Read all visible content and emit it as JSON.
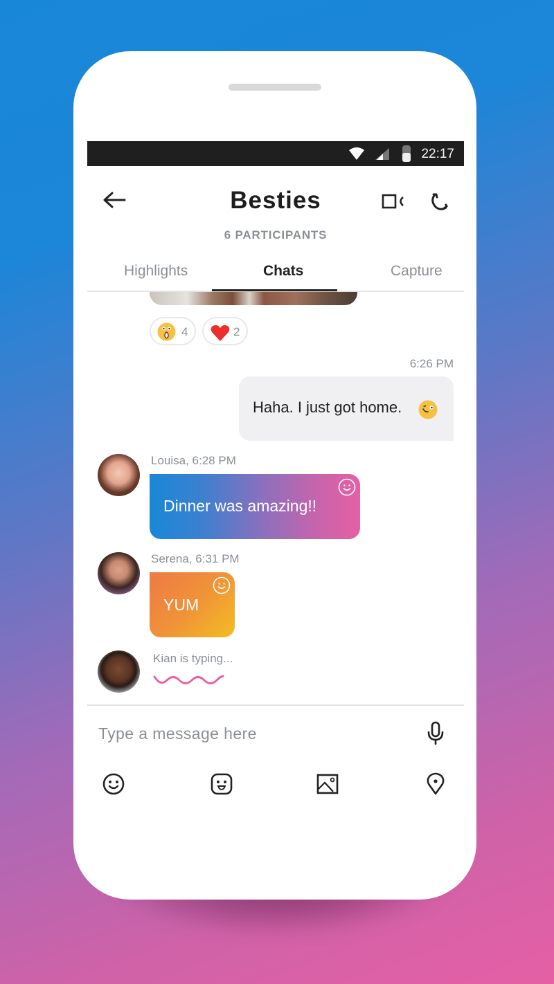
{
  "status_bar": {
    "time": "22:17",
    "icons": [
      "wifi-icon",
      "signal-icon",
      "battery-icon"
    ]
  },
  "header": {
    "title": "Besties",
    "subtitle": "6 PARTICIPANTS",
    "back_icon": "arrow-left-icon",
    "video_icon": "video-camera-icon",
    "call_icon": "phone-icon"
  },
  "tabs": [
    {
      "label": "Highlights",
      "active": false
    },
    {
      "label": "Chats",
      "active": true
    },
    {
      "label": "Capture",
      "active": false
    }
  ],
  "chat": {
    "reactions": [
      {
        "emoji": "surprised-emoji",
        "count": "4"
      },
      {
        "emoji": "heart-emoji",
        "count": "2"
      }
    ],
    "messages": [
      {
        "direction": "outgoing",
        "time": "6:26 PM",
        "text": "Haha. I just got home.",
        "emoji": "wink-emoji"
      },
      {
        "direction": "incoming",
        "sender": "Louisa, 6:28 PM",
        "text": "Dinner was amazing!!",
        "gradient": [
          "#1987d8",
          "#e560a5"
        ]
      },
      {
        "direction": "incoming",
        "sender": "Serena, 6:31 PM",
        "text": "YUM",
        "gradient": [
          "#ee7a45",
          "#f3bd23"
        ]
      }
    ],
    "typing": {
      "text": "Kian is typing...",
      "color": "#e560a5"
    }
  },
  "composer": {
    "placeholder": "Type a message here",
    "value": "",
    "tools": [
      "emoji-icon",
      "sticker-icon",
      "image-icon",
      "location-icon"
    ]
  },
  "colors": {
    "accent_blue": "#1987d8",
    "accent_pink": "#e560a5",
    "muted_text": "#8a8f96"
  }
}
